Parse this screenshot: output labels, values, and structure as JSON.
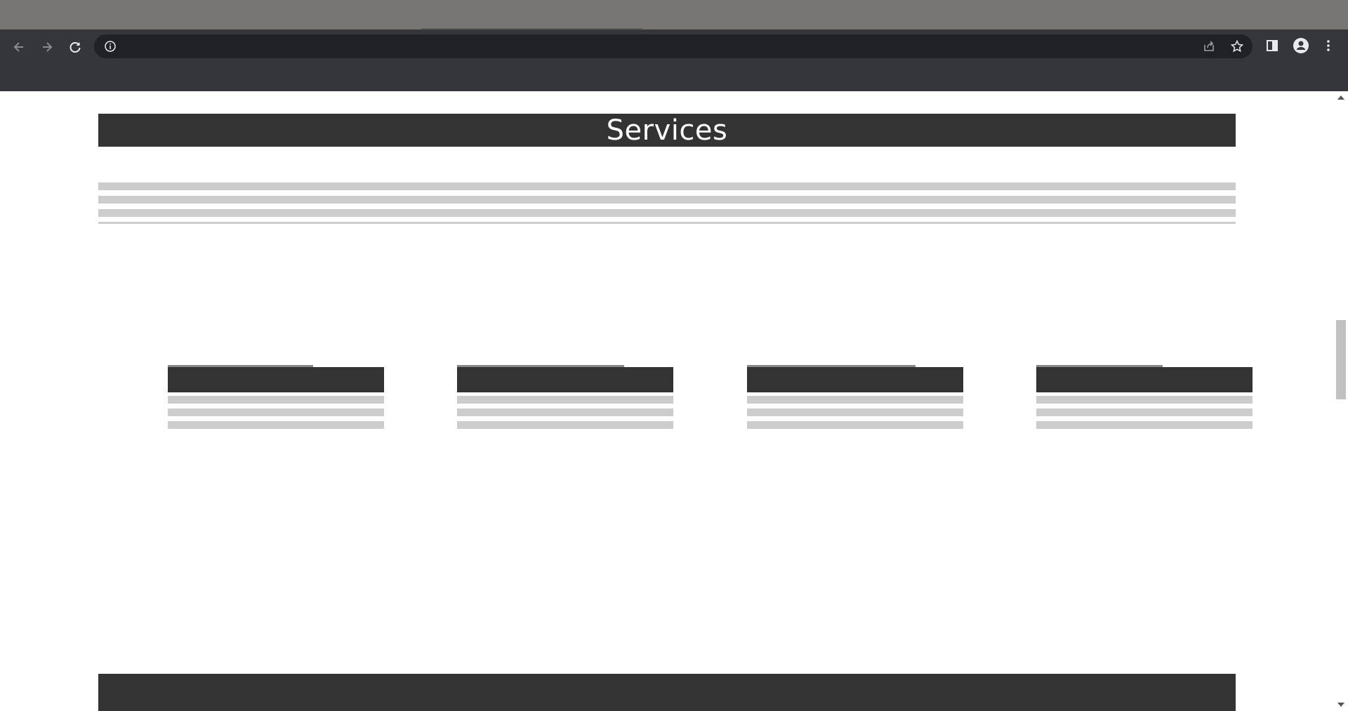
{
  "browser": {
    "url": "",
    "icons": {
      "back": "arrow-left-icon",
      "forward": "arrow-right-icon",
      "reload": "reload-icon",
      "site_info": "info-icon",
      "share": "share-icon",
      "bookmark": "star-icon",
      "side_panel": "side-panel-icon",
      "profile": "profile-icon",
      "menu": "kebab-menu-icon"
    }
  },
  "page": {
    "section_title": "Services",
    "cards_count_label": "",
    "colors": {
      "header_bg": "#333333",
      "placeholder_line": "#cccccc",
      "chrome_toolbar": "#35363a",
      "omnibox": "#202124"
    }
  }
}
